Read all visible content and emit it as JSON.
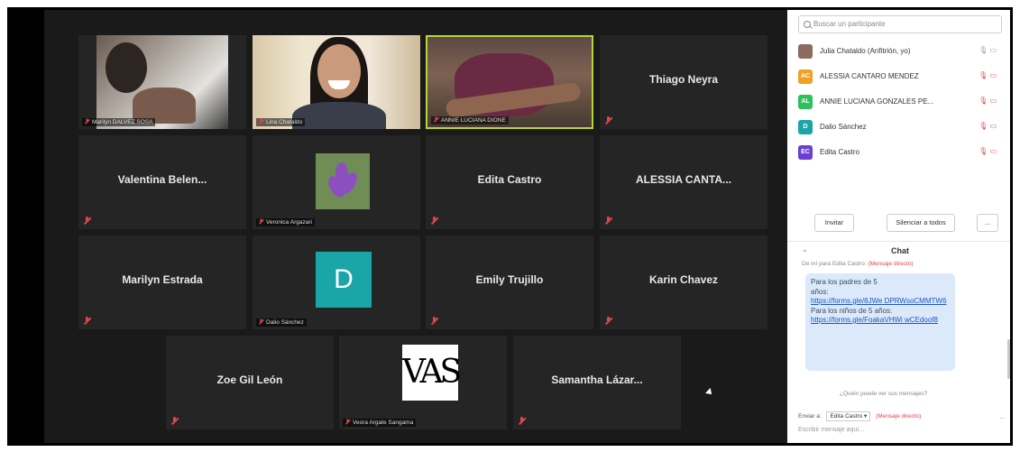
{
  "gallery": {
    "row1": [
      {
        "label": "Marilyn DALVEZ SOSA"
      },
      {
        "label": "Lina Chataldo"
      },
      {
        "label": "ANNIE LUCIANA DIONE"
      },
      {
        "name": "Thiago Neyra"
      }
    ],
    "row2": [
      {
        "name": "Valentina  Belen..."
      },
      {
        "label": "Veronica Argazari"
      },
      {
        "name": "Edita Castro"
      },
      {
        "name": "ALESSIA  CANTA..."
      }
    ],
    "row3": [
      {
        "name": "Marilyn Estrada"
      },
      {
        "label": "Dalio Sánchez",
        "avatar": "D"
      },
      {
        "name": "Emily Trujillo"
      },
      {
        "name": "Karin Chavez"
      }
    ],
    "row4": [
      {
        "name": "Zoe Gil León"
      },
      {
        "label": "Veora Argate Sangama",
        "logo": "VAS"
      },
      {
        "name": "Samantha  Lázar..."
      }
    ]
  },
  "participants": {
    "search_placeholder": "Buscar un participante",
    "list": [
      {
        "initials": "",
        "name": "Julia Chataldo (Anfitrión, yo)",
        "color": "#8a6b5d",
        "icons": "🎙 ▭"
      },
      {
        "initials": "AC",
        "name": "ALESSIA CANTARO MENDEZ",
        "color": "#f0a024",
        "icons": "🎙 ▭"
      },
      {
        "initials": "AL",
        "name": "ANNIE LUCIANA GONZALES PE...",
        "color": "#2fbf5e",
        "icons": "🎙 ▭"
      },
      {
        "initials": "D",
        "name": "Dalio Sánchez",
        "color": "#1aa5a8",
        "icons": "🎙 ▭"
      },
      {
        "initials": "EC",
        "name": "Edita Castro",
        "color": "#6b3fd1",
        "icons": "🎙 ▭"
      }
    ],
    "invite_label": "Invitar",
    "mute_all_label": "Silenciar a todos",
    "more_label": "..."
  },
  "chat": {
    "title": "Chat",
    "collapse": "⌄",
    "prev_text": "De mí para Edita Castro:",
    "prev_private": "(Mensaje directo)",
    "msg_line1": "Para los padres de 5",
    "msg_line2": "años:",
    "msg_link1": "https://forms.gle/8JWe DPRWsoCMMTW6",
    "msg_line3": "Para los niños de 5 años:",
    "msg_link2": "https://forms.gle/FoakaVHWi wCEdoof8",
    "typing_hint": "¿Quién puede ver sus mensajes?",
    "send_to_label": "Enviar a:",
    "send_to_value": "Edita Castro ▾",
    "direct_label": "(Mensaje directo)",
    "input_placeholder": "Escribir mensaje aquí...",
    "more_dots": "..."
  }
}
